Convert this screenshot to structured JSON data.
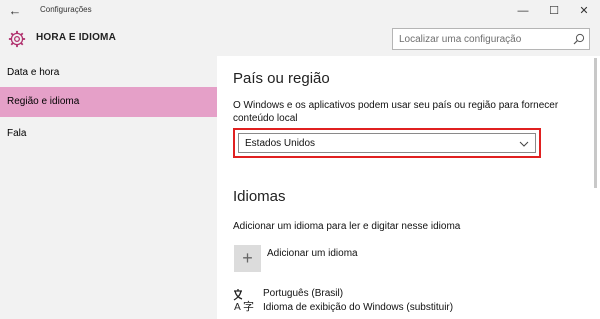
{
  "window": {
    "title": "Configurações",
    "back_icon": "arrow-left-icon",
    "minimize_glyph": "—",
    "maximize_glyph": "☐",
    "close_glyph": "✕"
  },
  "header": {
    "icon": "gear-icon",
    "title": "HORA E IDIOMA",
    "search_placeholder": "Localizar uma configuração"
  },
  "sidebar": {
    "items": [
      {
        "label": "Data e hora",
        "selected": false
      },
      {
        "label": "Região e idioma",
        "selected": true
      },
      {
        "label": "Fala",
        "selected": false
      }
    ]
  },
  "region": {
    "heading": "País ou região",
    "description": "O Windows e os aplicativos podem usar seu país ou região para fornecer conteúdo local",
    "selected_country": "Estados Unidos"
  },
  "languages": {
    "heading": "Idiomas",
    "description": "Adicionar um idioma para ler e digitar nesse idioma",
    "add_glyph": "+",
    "add_label": "Adicionar um idioma",
    "items": [
      {
        "name": "Português (Brasil)",
        "subtitle": "Idioma de exibição do Windows (substituir)"
      }
    ]
  },
  "colors": {
    "accent_selected": "#e5a0c8",
    "highlight_border": "#e02020",
    "chrome_bg": "#f2f2f2"
  }
}
